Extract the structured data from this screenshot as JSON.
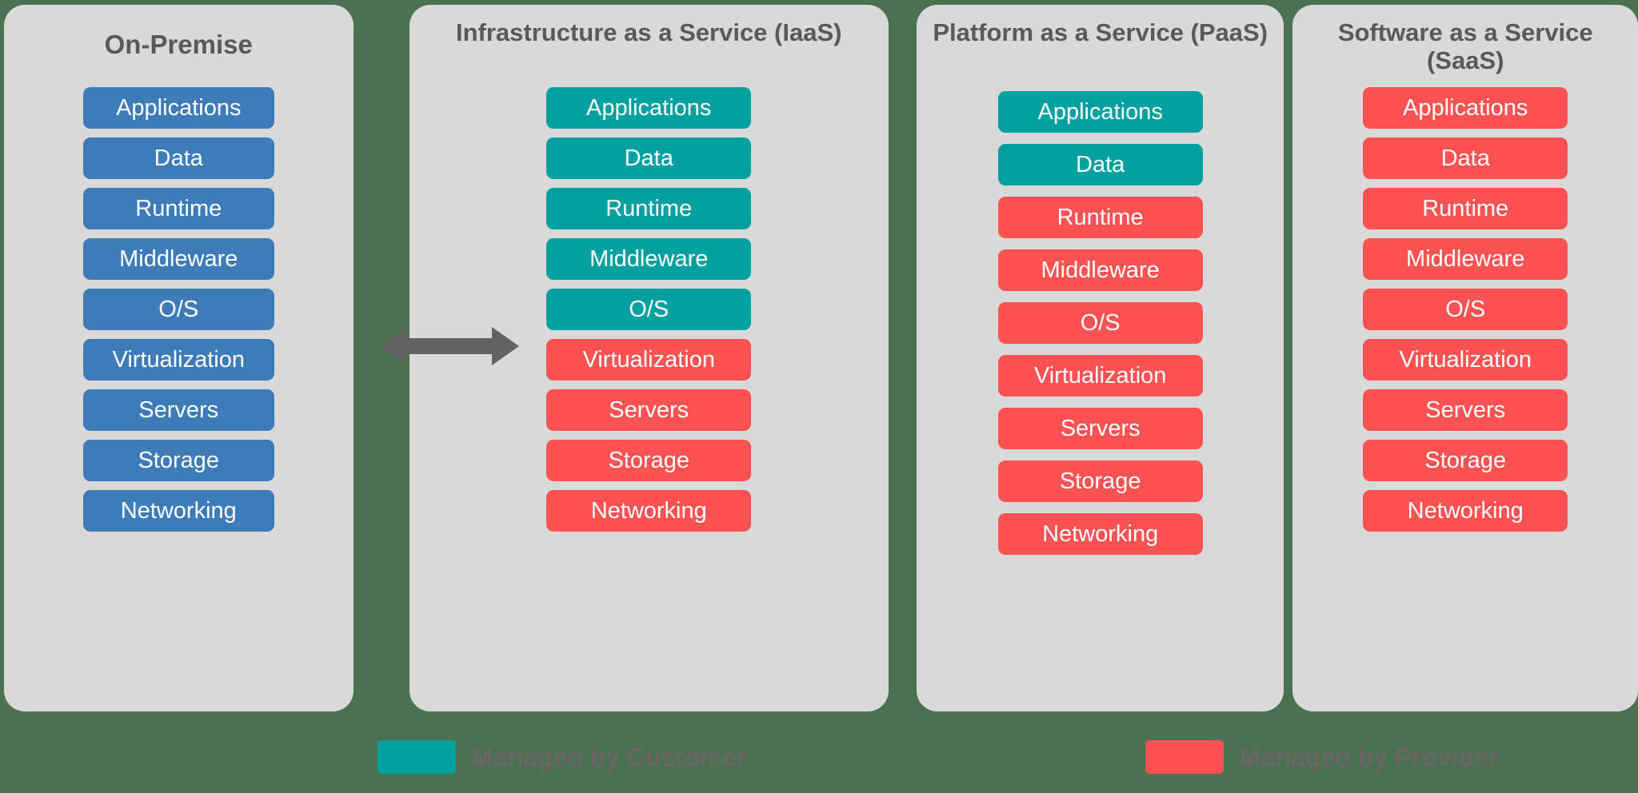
{
  "background_color": "#4a7150",
  "card_color": "#d9d9d9",
  "colors": {
    "onpremise": "#3d7cb8",
    "customer": "#00a0a0",
    "provider": "#ff5252",
    "title_text": "#595959",
    "legend_text": "#6b6566",
    "arrow": "#636363"
  },
  "columns": [
    {
      "id": "on-premise",
      "title": "On-Premise",
      "layers": [
        {
          "label": "Applications",
          "color": "#3d7cb8",
          "managed_by": "customer"
        },
        {
          "label": "Data",
          "color": "#3d7cb8",
          "managed_by": "customer"
        },
        {
          "label": "Runtime",
          "color": "#3d7cb8",
          "managed_by": "customer"
        },
        {
          "label": "Middleware",
          "color": "#3d7cb8",
          "managed_by": "customer"
        },
        {
          "label": "O/S",
          "color": "#3d7cb8",
          "managed_by": "customer"
        },
        {
          "label": "Virtualization",
          "color": "#3d7cb8",
          "managed_by": "customer"
        },
        {
          "label": "Servers",
          "color": "#3d7cb8",
          "managed_by": "customer"
        },
        {
          "label": "Storage",
          "color": "#3d7cb8",
          "managed_by": "customer"
        },
        {
          "label": "Networking",
          "color": "#3d7cb8",
          "managed_by": "customer"
        }
      ]
    },
    {
      "id": "iaas",
      "title": "Infrastructure as a Service (IaaS)",
      "layers": [
        {
          "label": "Applications",
          "color": "#00a0a0",
          "managed_by": "customer"
        },
        {
          "label": "Data",
          "color": "#00a0a0",
          "managed_by": "customer"
        },
        {
          "label": "Runtime",
          "color": "#00a0a0",
          "managed_by": "customer"
        },
        {
          "label": "Middleware",
          "color": "#00a0a0",
          "managed_by": "customer"
        },
        {
          "label": "O/S",
          "color": "#00a0a0",
          "managed_by": "customer"
        },
        {
          "label": "Virtualization",
          "color": "#ff5252",
          "managed_by": "provider"
        },
        {
          "label": "Servers",
          "color": "#ff5252",
          "managed_by": "provider"
        },
        {
          "label": "Storage",
          "color": "#ff5252",
          "managed_by": "provider"
        },
        {
          "label": "Networking",
          "color": "#ff5252",
          "managed_by": "provider"
        }
      ]
    },
    {
      "id": "paas",
      "title": "Platform as a Service (PaaS)",
      "layers": [
        {
          "label": "Applications",
          "color": "#00a0a0",
          "managed_by": "customer"
        },
        {
          "label": "Data",
          "color": "#00a0a0",
          "managed_by": "customer"
        },
        {
          "label": "Runtime",
          "color": "#ff5252",
          "managed_by": "provider"
        },
        {
          "label": "Middleware",
          "color": "#ff5252",
          "managed_by": "provider"
        },
        {
          "label": "O/S",
          "color": "#ff5252",
          "managed_by": "provider"
        },
        {
          "label": "Virtualization",
          "color": "#ff5252",
          "managed_by": "provider"
        },
        {
          "label": "Servers",
          "color": "#ff5252",
          "managed_by": "provider"
        },
        {
          "label": "Storage",
          "color": "#ff5252",
          "managed_by": "provider"
        },
        {
          "label": "Networking",
          "color": "#ff5252",
          "managed_by": "provider"
        }
      ]
    },
    {
      "id": "saas",
      "title": "Software as a Service (SaaS)",
      "layers": [
        {
          "label": "Applications",
          "color": "#ff5252",
          "managed_by": "provider"
        },
        {
          "label": "Data",
          "color": "#ff5252",
          "managed_by": "provider"
        },
        {
          "label": "Runtime",
          "color": "#ff5252",
          "managed_by": "provider"
        },
        {
          "label": "Middleware",
          "color": "#ff5252",
          "managed_by": "provider"
        },
        {
          "label": "O/S",
          "color": "#ff5252",
          "managed_by": "provider"
        },
        {
          "label": "Virtualization",
          "color": "#ff5252",
          "managed_by": "provider"
        },
        {
          "label": "Servers",
          "color": "#ff5252",
          "managed_by": "provider"
        },
        {
          "label": "Storage",
          "color": "#ff5252",
          "managed_by": "provider"
        },
        {
          "label": "Networking",
          "color": "#ff5252",
          "managed_by": "provider"
        }
      ]
    }
  ],
  "arrow": {
    "icon": "double-headed-arrow-icon",
    "color": "#636363"
  },
  "legend": [
    {
      "label": "Managed by Customer",
      "color": "#00a0a0"
    },
    {
      "label": "Managed by Provider",
      "color": "#ff5252"
    }
  ]
}
